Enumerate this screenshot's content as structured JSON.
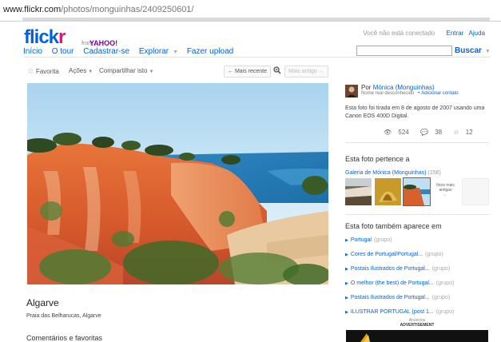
{
  "browser": {
    "url_host": "www.flickr.com",
    "url_path": "/photos/monguinhas/2409250601/"
  },
  "header": {
    "logo_text": "flick",
    "logo_accent": "r",
    "logo_by": "from",
    "logo_yahoo": "YAHOO!",
    "status_text": "Você não está conectado",
    "signin_label": "Entrar",
    "help_label": "Ajuda",
    "nav": {
      "home": "Início",
      "tour": "O tour",
      "signup": "Cadastrar-se",
      "explore": "Explorar",
      "upload": "Fazer upload"
    },
    "search_button": "Buscar"
  },
  "toolbar": {
    "favorite": "Favorita",
    "actions": "Ações",
    "share": "Compartilhar isto",
    "newer": "← Mais recente",
    "older": "Mais antigo →"
  },
  "photo": {
    "title": "Algarve",
    "location": "Praia das Belharucas, Algarve"
  },
  "comments": {
    "title": "Comentários e favoritas"
  },
  "owner": {
    "by": "Por",
    "name": "Mónica (Monguinhas)",
    "realname_status": "Nome real desconhecido",
    "add_contact": "+ Adicionar contato",
    "description": "Esta foto foi tirada em 8 de agosto de 2007 usando uma Canon EOS 400D Digital."
  },
  "stats": {
    "views": "524",
    "comments": "38",
    "favorites": "12"
  },
  "belongs": {
    "title": "Esta foto pertence a",
    "gallery_name": "Galeria de Mónica (Monguinhas)",
    "gallery_count": "(156)",
    "older_label_1": "fotos mais",
    "older_label_2": "antigas",
    "older_arrow": "←"
  },
  "also_in": {
    "title": "Esta foto também aparece em",
    "groups": [
      {
        "name": "Portugal",
        "tag": "(grupo)"
      },
      {
        "name": "Cores de Portugal/Portugal...",
        "tag": "(grupo)"
      },
      {
        "name": "Postais Ilustrados de Portugal...",
        "tag": "(grupo)"
      },
      {
        "name": "O melhor (the best) de Portugal...",
        "tag": "(grupo)"
      },
      {
        "name": "Postais Ilustrados de Portugal...",
        "tag": "(grupo)"
      },
      {
        "name": "ILUSTRAR PORTUGAL (post 1...",
        "tag": "(grupo)"
      }
    ]
  },
  "ads": {
    "label": "Anúncios",
    "advertisement": "ADVERTISEMENT"
  },
  "colors": {
    "flickr_blue": "#0063dc",
    "flickr_pink": "#ff0084"
  }
}
